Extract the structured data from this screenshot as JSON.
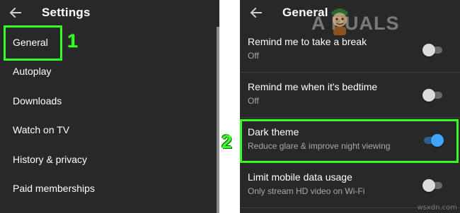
{
  "left_panel": {
    "title": "Settings",
    "items": [
      {
        "label": "General"
      },
      {
        "label": "Autoplay"
      },
      {
        "label": "Downloads"
      },
      {
        "label": "Watch on TV"
      },
      {
        "label": "History & privacy"
      },
      {
        "label": "Paid memberships"
      }
    ]
  },
  "right_panel": {
    "title": "General",
    "settings": [
      {
        "title": "Remind me to take a break",
        "subtitle": "Off",
        "toggle_on": false
      },
      {
        "title": "Remind me when it's bedtime",
        "subtitle": "Off",
        "toggle_on": false
      },
      {
        "title": "Dark theme",
        "subtitle": "Reduce glare & improve night viewing",
        "toggle_on": true
      },
      {
        "title": "Limit mobile data usage",
        "subtitle": "Only stream HD video on Wi-Fi",
        "toggle_on": false
      }
    ]
  },
  "annotations": {
    "step1": "1",
    "step2": "2",
    "highlight_color": "#33ff22"
  },
  "watermark": {
    "text": "A  PUALS"
  },
  "site_credit": "wsxdn.com",
  "colors": {
    "background": "#282828",
    "accent": "#3ea6ff"
  }
}
